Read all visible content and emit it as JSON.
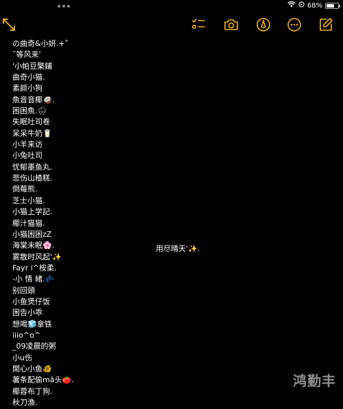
{
  "status_bar": {
    "battery_text": "68%",
    "battery_level": 0.68
  },
  "toolbar": {
    "accent_color": "#f2b51b",
    "icons": [
      "expand-icon",
      "checklist-icon",
      "camera-icon",
      "markup-pen-icon",
      "more-icon",
      "compose-icon"
    ]
  },
  "note": {
    "lines": [
      "の曲奇&小妍.+˚",
      "˜等风来'",
      "'小帕豆檠鋪",
      "曲奇小猫.",
      "素颜小狗",
      "魚音音椰🥥.",
      "困困魚.🌧",
      "失眠吐司卷",
      "呆呆牛奶🥛",
      "小羊来访",
      "小兔吐司",
      "忧郁墨鱼丸.",
      "悲伤山楂糕.",
      "倒莓熊.",
      "芝士小猫.",
      "小猫上学記.",
      "椰汁猫猫.",
      "小猫困困zZ",
      "海棠未眠🌸.",
      "雾散时风起'✨",
      "Fayr i^桉柔.",
      "-小  情  緒.💤",
      "别回頭",
      "小鱼煲仔饭",
      "困告小乖",
      "想喝🧊拿铁",
      "iiio^o^",
      "_09凌晨的粥",
      "小u伤",
      "開心小鱼🐠",
      "薯条配偷mā头🍅.",
      "椰蓉布丁狗.",
      "秋刀漁."
    ]
  },
  "right_text": "用尽晴天'✨.",
  "watermark": "鸿勤丰"
}
